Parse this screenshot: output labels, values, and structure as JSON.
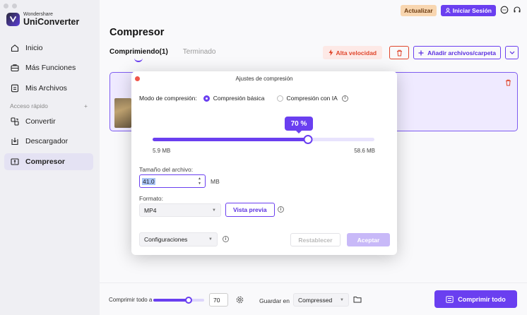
{
  "brand": {
    "small": "Wondershare",
    "name": "UniConverter"
  },
  "sidebar": {
    "items": [
      {
        "label": "Inicio",
        "icon": "home-icon"
      },
      {
        "label": "Más Funciones",
        "icon": "toolbox-icon"
      },
      {
        "label": "Mis Archivos",
        "icon": "file-icon"
      }
    ],
    "quick_label": "Acceso rápido",
    "quick_plus": "+",
    "quick_items": [
      {
        "label": "Convertir",
        "icon": "convert-icon"
      },
      {
        "label": "Descargador",
        "icon": "download-icon"
      },
      {
        "label": "Compresor",
        "icon": "compress-icon",
        "active": true
      }
    ]
  },
  "topbar": {
    "upgrade_label": "Actualizar",
    "login_label": "Iniciar Sesión"
  },
  "page": {
    "title": "Compresor"
  },
  "tabs": [
    {
      "label": "Comprimiendo(1)",
      "active": true
    },
    {
      "label": "Terminado",
      "active": false
    }
  ],
  "actions": {
    "speed_label": "Alta velocidad",
    "add_label": "Añadir archivos/carpeta"
  },
  "dialog": {
    "title": "Ajustes de compresión",
    "mode_label": "Modo de compresión:",
    "mode_basic": "Compresión básica",
    "mode_ai": "Compresión con IA",
    "mode_selected": "basic",
    "percent_label": "70 %",
    "percent_value": 0.7,
    "size_min": "5.9 MB",
    "size_max": "58.6 MB",
    "file_size_label": "Tamaño del archivo:",
    "file_size_value": "41.0",
    "file_size_unit": "MB",
    "format_label": "Formato:",
    "format_value": "MP4",
    "preview_label": "Vista previa",
    "config_value": "Configuraciones",
    "reset_label": "Restablecer",
    "accept_label": "Aceptar"
  },
  "bottombar": {
    "compress_all_label": "Comprimir todo a",
    "compress_all_value": "70",
    "compress_all_fraction": 0.7,
    "save_label": "Guardar en",
    "save_location": "Compressed",
    "compress_button": "Comprimir todo"
  },
  "colors": {
    "accent": "#6a3ff0",
    "danger": "#e0462c",
    "upgrade": "#f8d6b0"
  }
}
